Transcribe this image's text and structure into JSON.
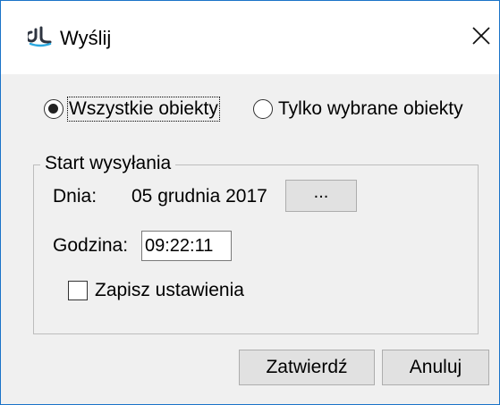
{
  "window": {
    "title": "Wyślij",
    "icon": "dl-logo-icon",
    "close_icon": "close-icon"
  },
  "scope": {
    "options": [
      {
        "label": "Wszystkie obiekty",
        "checked": true
      },
      {
        "label": "Tylko wybrane obiekty",
        "checked": false
      }
    ]
  },
  "start": {
    "group_label": "Start wysyłania",
    "day_label": "Dnia:",
    "day_value": "05 grudnia 2017",
    "date_picker_label": "...",
    "time_label": "Godzina:",
    "time_value": "09:22:11"
  },
  "save_settings": {
    "label": "Zapisz ustawienia",
    "checked": false
  },
  "buttons": {
    "confirm": "Zatwierdź",
    "cancel": "Anuluj"
  },
  "colors": {
    "window_border": "#1a73c8",
    "logo_dark": "#2e3440",
    "logo_accent": "#2aa8e0",
    "client_bg": "#f0f0f0",
    "button_bg": "#e1e1e1"
  }
}
